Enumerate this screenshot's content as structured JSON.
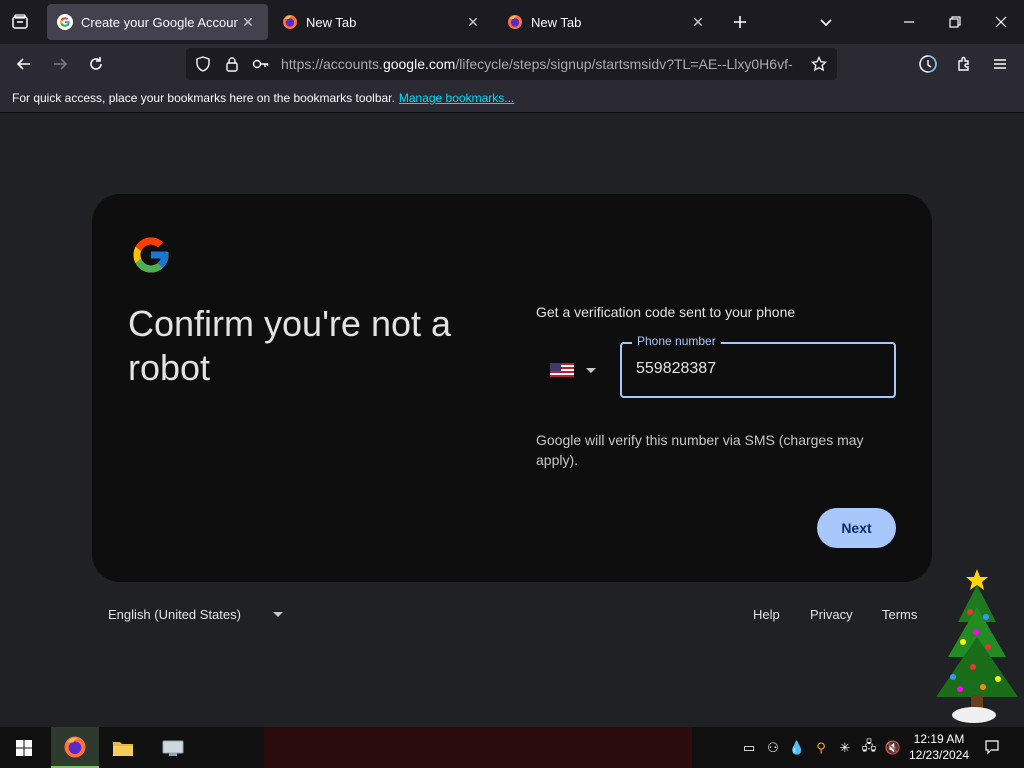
{
  "browser": {
    "tabs": [
      {
        "title": "Create your Google Account",
        "active": true
      },
      {
        "title": "New Tab",
        "active": false
      },
      {
        "title": "New Tab",
        "active": false
      }
    ],
    "url": {
      "prefix": "https://accounts.",
      "host": "google.com",
      "path": "/lifecycle/steps/signup/startsmsidv?TL=AE--Llxy0H6vf-"
    },
    "bookmarks_bar": {
      "message": "For quick access, place your bookmarks here on the bookmarks toolbar.",
      "link": "Manage bookmarks..."
    }
  },
  "signup": {
    "heading": "Confirm you're not a robot",
    "prompt": "Get a verification code sent to your phone",
    "country_flag": "us-flag-icon",
    "phone_label": "Phone number",
    "phone_value": "559828387",
    "sms_note": "Google will verify this number via SMS (charges may apply).",
    "next_label": "Next"
  },
  "footer": {
    "language": "English (United States)",
    "links": [
      "Help",
      "Privacy",
      "Terms"
    ]
  },
  "taskbar": {
    "time": "12:19 AM",
    "date": "12/23/2024"
  },
  "colors": {
    "accent": "#a8c7fa",
    "card_bg": "#0e0e0e",
    "page_bg": "#202124"
  }
}
